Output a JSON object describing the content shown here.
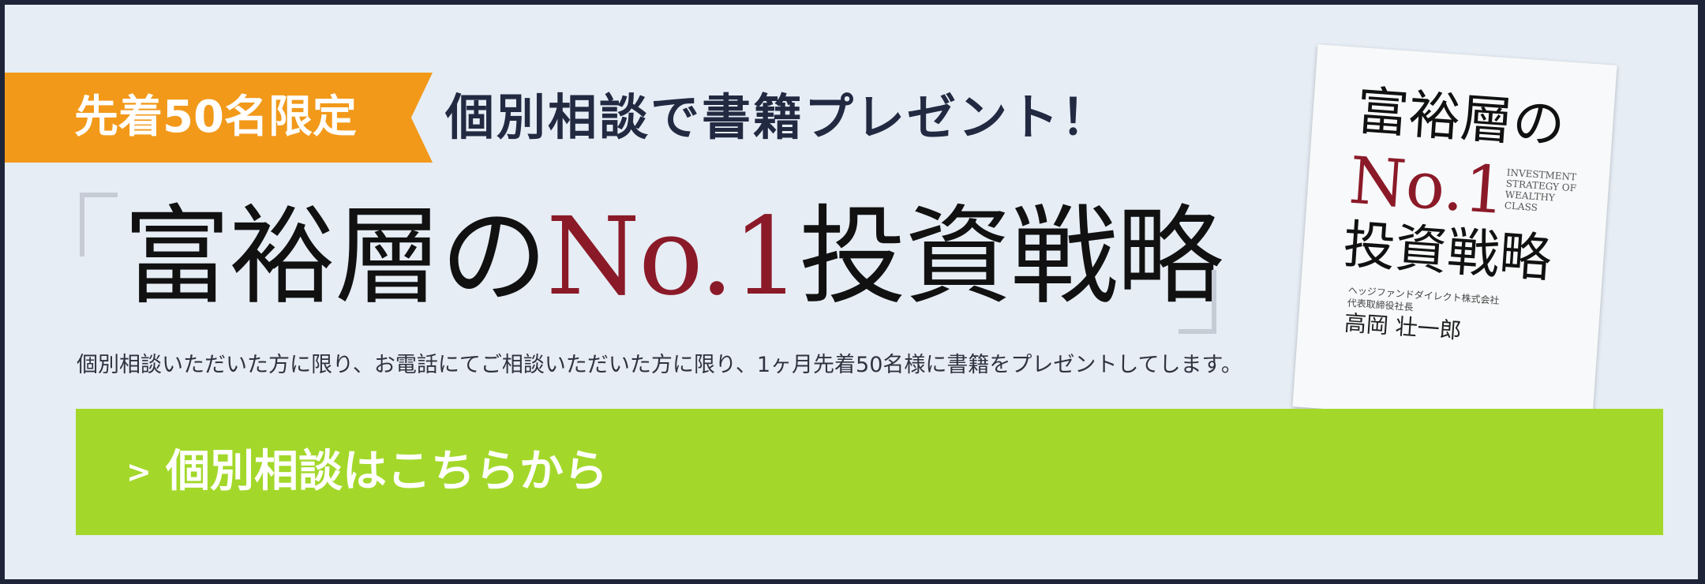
{
  "ribbon": {
    "label": "先着50名限定",
    "color": "#f2991a"
  },
  "headline": "個別相談で書籍プレゼント！",
  "title": {
    "part1": "富裕層の",
    "accent": "No.1",
    "part2": "投資戦略",
    "accent_color": "#8b1a28"
  },
  "description": "個別相談いただいた方に限り、お電話にてご相談いただいた方に限り、1ヶ月先着50名様に書籍をプレゼントしてします。",
  "book": {
    "line1": "富裕層の",
    "line2": "No.1",
    "line3": "投資戦略",
    "english": [
      "INVESTMENT",
      "STRATEGY OF",
      "WEALTHY",
      "CLASS"
    ],
    "publisher": [
      "ヘッジファンドダイレクト株式会社",
      "代表取締役社長"
    ],
    "author": "高岡 壮一郎"
  },
  "cta": {
    "icon": "chevron-right-icon",
    "label": "個別相談はこちらから",
    "color": "#a3d82a"
  },
  "colors": {
    "background": "#e6edf5",
    "frame": "#1f2538",
    "headline": "#222a42"
  }
}
